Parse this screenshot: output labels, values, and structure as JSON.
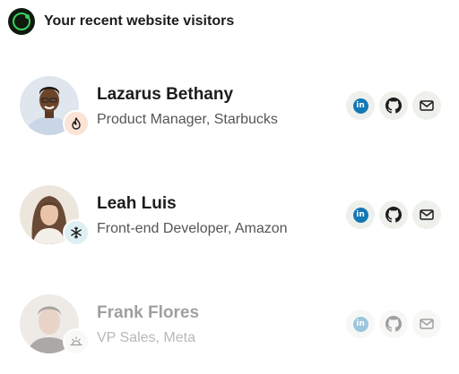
{
  "header": {
    "title": "Your recent website visitors"
  },
  "visitors": [
    {
      "name": "Lazarus Bethany",
      "role": "Product Manager, Starbucks",
      "status_icon": "flame-icon"
    },
    {
      "name": "Leah Luis",
      "role": "Front-end Developer, Amazon",
      "status_icon": "snowflake-icon"
    },
    {
      "name": "Frank Flores",
      "role": "VP Sales, Meta",
      "status_icon": "sun-icon"
    }
  ],
  "social_icons": [
    "linkedin-icon",
    "github-icon",
    "mail-icon"
  ],
  "linkedin_glyph": "in",
  "colors": {
    "brand_green": "#3ccf5a",
    "linkedin_blue": "#1478b5",
    "hot_badge": "#fbe3d5",
    "cold_badge": "#dff0f5"
  }
}
